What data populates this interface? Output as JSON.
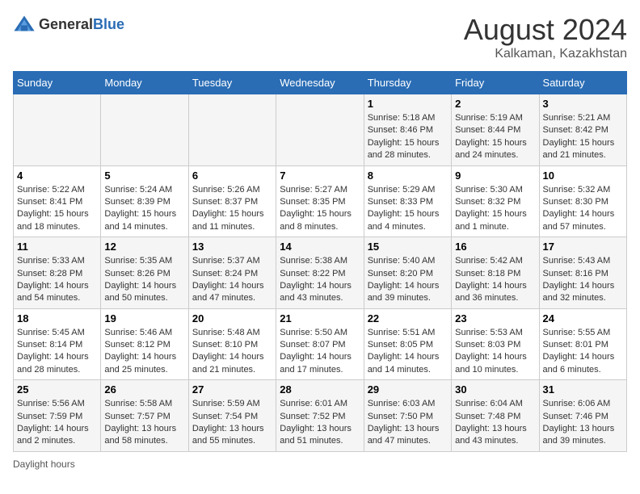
{
  "header": {
    "logo_general": "General",
    "logo_blue": "Blue",
    "month_year": "August 2024",
    "location": "Kalkaman, Kazakhstan"
  },
  "days_of_week": [
    "Sunday",
    "Monday",
    "Tuesday",
    "Wednesday",
    "Thursday",
    "Friday",
    "Saturday"
  ],
  "footer": "Daylight hours",
  "weeks": [
    [
      {
        "num": "",
        "info": ""
      },
      {
        "num": "",
        "info": ""
      },
      {
        "num": "",
        "info": ""
      },
      {
        "num": "",
        "info": ""
      },
      {
        "num": "1",
        "info": "Sunrise: 5:18 AM\nSunset: 8:46 PM\nDaylight: 15 hours\nand 28 minutes."
      },
      {
        "num": "2",
        "info": "Sunrise: 5:19 AM\nSunset: 8:44 PM\nDaylight: 15 hours\nand 24 minutes."
      },
      {
        "num": "3",
        "info": "Sunrise: 5:21 AM\nSunset: 8:42 PM\nDaylight: 15 hours\nand 21 minutes."
      }
    ],
    [
      {
        "num": "4",
        "info": "Sunrise: 5:22 AM\nSunset: 8:41 PM\nDaylight: 15 hours\nand 18 minutes."
      },
      {
        "num": "5",
        "info": "Sunrise: 5:24 AM\nSunset: 8:39 PM\nDaylight: 15 hours\nand 14 minutes."
      },
      {
        "num": "6",
        "info": "Sunrise: 5:26 AM\nSunset: 8:37 PM\nDaylight: 15 hours\nand 11 minutes."
      },
      {
        "num": "7",
        "info": "Sunrise: 5:27 AM\nSunset: 8:35 PM\nDaylight: 15 hours\nand 8 minutes."
      },
      {
        "num": "8",
        "info": "Sunrise: 5:29 AM\nSunset: 8:33 PM\nDaylight: 15 hours\nand 4 minutes."
      },
      {
        "num": "9",
        "info": "Sunrise: 5:30 AM\nSunset: 8:32 PM\nDaylight: 15 hours\nand 1 minute."
      },
      {
        "num": "10",
        "info": "Sunrise: 5:32 AM\nSunset: 8:30 PM\nDaylight: 14 hours\nand 57 minutes."
      }
    ],
    [
      {
        "num": "11",
        "info": "Sunrise: 5:33 AM\nSunset: 8:28 PM\nDaylight: 14 hours\nand 54 minutes."
      },
      {
        "num": "12",
        "info": "Sunrise: 5:35 AM\nSunset: 8:26 PM\nDaylight: 14 hours\nand 50 minutes."
      },
      {
        "num": "13",
        "info": "Sunrise: 5:37 AM\nSunset: 8:24 PM\nDaylight: 14 hours\nand 47 minutes."
      },
      {
        "num": "14",
        "info": "Sunrise: 5:38 AM\nSunset: 8:22 PM\nDaylight: 14 hours\nand 43 minutes."
      },
      {
        "num": "15",
        "info": "Sunrise: 5:40 AM\nSunset: 8:20 PM\nDaylight: 14 hours\nand 39 minutes."
      },
      {
        "num": "16",
        "info": "Sunrise: 5:42 AM\nSunset: 8:18 PM\nDaylight: 14 hours\nand 36 minutes."
      },
      {
        "num": "17",
        "info": "Sunrise: 5:43 AM\nSunset: 8:16 PM\nDaylight: 14 hours\nand 32 minutes."
      }
    ],
    [
      {
        "num": "18",
        "info": "Sunrise: 5:45 AM\nSunset: 8:14 PM\nDaylight: 14 hours\nand 28 minutes."
      },
      {
        "num": "19",
        "info": "Sunrise: 5:46 AM\nSunset: 8:12 PM\nDaylight: 14 hours\nand 25 minutes."
      },
      {
        "num": "20",
        "info": "Sunrise: 5:48 AM\nSunset: 8:10 PM\nDaylight: 14 hours\nand 21 minutes."
      },
      {
        "num": "21",
        "info": "Sunrise: 5:50 AM\nSunset: 8:07 PM\nDaylight: 14 hours\nand 17 minutes."
      },
      {
        "num": "22",
        "info": "Sunrise: 5:51 AM\nSunset: 8:05 PM\nDaylight: 14 hours\nand 14 minutes."
      },
      {
        "num": "23",
        "info": "Sunrise: 5:53 AM\nSunset: 8:03 PM\nDaylight: 14 hours\nand 10 minutes."
      },
      {
        "num": "24",
        "info": "Sunrise: 5:55 AM\nSunset: 8:01 PM\nDaylight: 14 hours\nand 6 minutes."
      }
    ],
    [
      {
        "num": "25",
        "info": "Sunrise: 5:56 AM\nSunset: 7:59 PM\nDaylight: 14 hours\nand 2 minutes."
      },
      {
        "num": "26",
        "info": "Sunrise: 5:58 AM\nSunset: 7:57 PM\nDaylight: 13 hours\nand 58 minutes."
      },
      {
        "num": "27",
        "info": "Sunrise: 5:59 AM\nSunset: 7:54 PM\nDaylight: 13 hours\nand 55 minutes."
      },
      {
        "num": "28",
        "info": "Sunrise: 6:01 AM\nSunset: 7:52 PM\nDaylight: 13 hours\nand 51 minutes."
      },
      {
        "num": "29",
        "info": "Sunrise: 6:03 AM\nSunset: 7:50 PM\nDaylight: 13 hours\nand 47 minutes."
      },
      {
        "num": "30",
        "info": "Sunrise: 6:04 AM\nSunset: 7:48 PM\nDaylight: 13 hours\nand 43 minutes."
      },
      {
        "num": "31",
        "info": "Sunrise: 6:06 AM\nSunset: 7:46 PM\nDaylight: 13 hours\nand 39 minutes."
      }
    ]
  ]
}
